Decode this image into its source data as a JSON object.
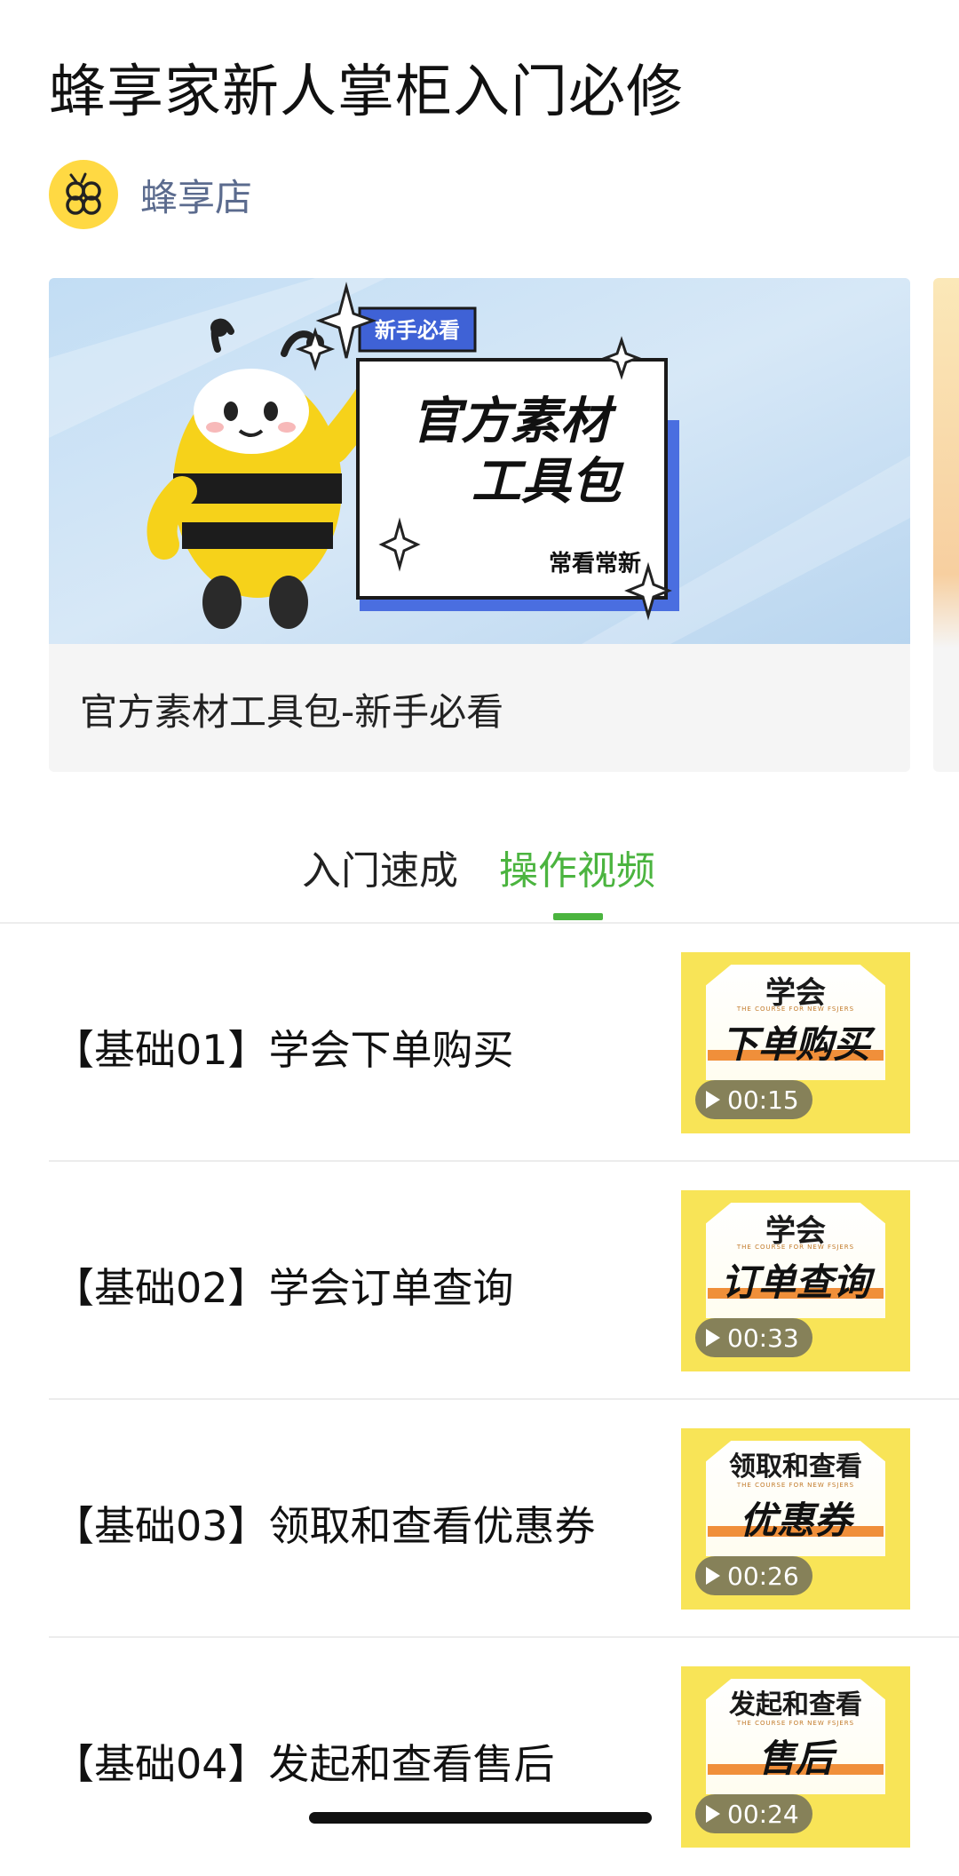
{
  "page": {
    "title": "蜂享家新人掌柜入门必修",
    "author": "蜂享店"
  },
  "banner": {
    "badge": "新手必看",
    "headline_line1": "官方素材",
    "headline_line2": "工具包",
    "tagline": "常看常新",
    "caption": "官方素材工具包-新手必看"
  },
  "tabs": [
    {
      "label": "入门速成",
      "active": false
    },
    {
      "label": "操作视频",
      "active": true
    }
  ],
  "videos": [
    {
      "title": "【基础01】学会下单购买",
      "thumb_top": "学会",
      "thumb_sub": "THE COURSE FOR NEW FSJERS",
      "thumb_main": "下单购买",
      "duration": "00:15"
    },
    {
      "title": "【基础02】学会订单查询",
      "thumb_top": "学会",
      "thumb_sub": "THE COURSE FOR NEW FSJERS",
      "thumb_main": "订单查询",
      "duration": "00:33"
    },
    {
      "title": "【基础03】领取和查看优惠券",
      "thumb_top": "领取和查看",
      "thumb_sub": "THE COURSE FOR NEW FSJERS",
      "thumb_main": "优惠券",
      "duration": "00:26"
    },
    {
      "title": "【基础04】发起和查看售后",
      "thumb_top": "发起和查看",
      "thumb_sub": "THE COURSE FOR NEW FSJERS",
      "thumb_main": "售后",
      "duration": "00:24"
    }
  ],
  "colors": {
    "accent_green": "#4bb43f",
    "author_blue": "#5b6b8e",
    "thumb_yellow": "#f8e457",
    "brand_yellow": "#ffd943"
  }
}
